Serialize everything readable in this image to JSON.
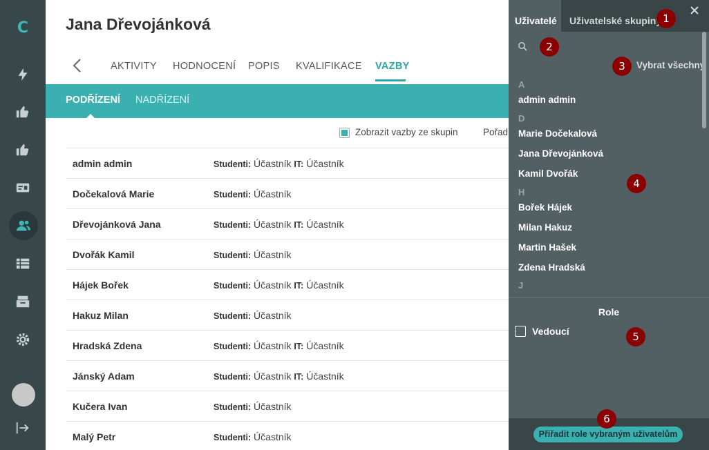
{
  "app": {
    "logo_text": "C"
  },
  "rail": {
    "icons": [
      "bolt-icon",
      "thumbs-up-icon",
      "thumbs-up-icon",
      "id-card-icon",
      "users-icon",
      "table-icon",
      "archive-icon",
      "gear-icon",
      "logout-icon"
    ]
  },
  "page": {
    "title": "Jana Dřevojánková",
    "tabs": [
      "AKTIVITY",
      "HODNOCENÍ",
      "POPIS",
      "KVALIFIKACE",
      "VAZBY"
    ],
    "active_tab": "VAZBY",
    "subtabs": [
      "PODŘÍZENÍ",
      "NADŘÍZENÍ"
    ],
    "filter_label": "Zobrazit vazby ze skupin",
    "order_label": "Pořad",
    "rows": [
      {
        "name": "admin admin",
        "r1": "Studenti:",
        "v1": " Účastník ",
        "r2": "IT:",
        "v2": " Účastník"
      },
      {
        "name": "Dočekalová Marie",
        "r1": "Studenti:",
        "v1": " Účastník",
        "r2": "",
        "v2": ""
      },
      {
        "name": "Dřevojánková Jana",
        "r1": "Studenti:",
        "v1": " Účastník ",
        "r2": "IT:",
        "v2": " Účastník"
      },
      {
        "name": "Dvořák Kamil",
        "r1": "Studenti:",
        "v1": " Účastník",
        "r2": "",
        "v2": ""
      },
      {
        "name": "Hájek Bořek",
        "r1": "Studenti:",
        "v1": " Účastník ",
        "r2": "IT:",
        "v2": " Účastník"
      },
      {
        "name": "Hakuz Milan",
        "r1": "Studenti:",
        "v1": " Účastník",
        "r2": "",
        "v2": ""
      },
      {
        "name": "Hradská Zdena",
        "r1": "Studenti:",
        "v1": " Účastník ",
        "r2": "IT:",
        "v2": " Účastník"
      },
      {
        "name": "Jánský Adam",
        "r1": "Studenti:",
        "v1": " Účastník ",
        "r2": "IT:",
        "v2": " Účastník"
      },
      {
        "name": "Kučera Ivan",
        "r1": "Studenti:",
        "v1": " Účastník",
        "r2": "",
        "v2": ""
      },
      {
        "name": "Malý Petr",
        "r1": "Studenti:",
        "v1": " Účastník",
        "r2": "",
        "v2": ""
      }
    ]
  },
  "panel": {
    "tabs": [
      "Uživatelé",
      "Uživatelské skupiny"
    ],
    "select_all": "Vybrat všechny",
    "letters": [
      "A",
      "D",
      "H",
      "J"
    ],
    "users_a": [
      "admin admin"
    ],
    "users_d": [
      "Marie Dočekalová",
      "Jana Dřevojánková",
      "Kamil Dvořák"
    ],
    "users_h": [
      "Bořek Hájek",
      "Milan Hakuz",
      "Martin Hašek",
      "Zdena Hradská"
    ],
    "role_title": "Role",
    "role_option": "Vedoucí",
    "assign_button": "Přiřadit role vybraným uživatelům"
  },
  "badges": [
    "1",
    "2",
    "3",
    "4",
    "5",
    "6"
  ],
  "colors": {
    "accent": "#3ab0b0",
    "rail": "#37474a",
    "panel": "#525f63",
    "badge": "#8b0000"
  }
}
